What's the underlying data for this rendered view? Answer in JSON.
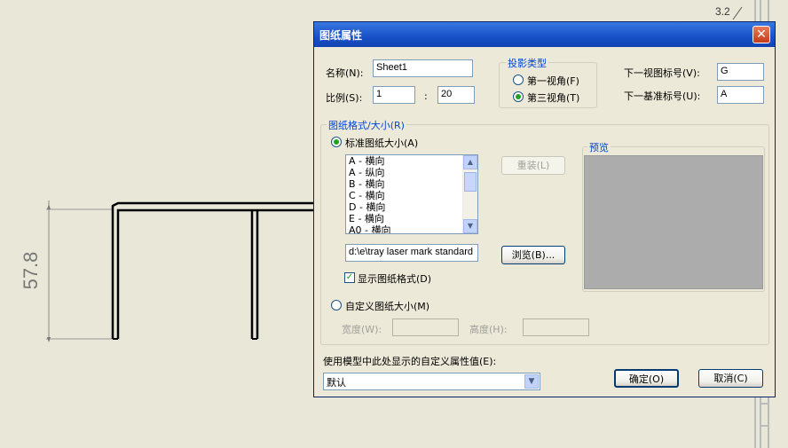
{
  "background": {
    "corner_label": "3.2",
    "dimension_label": "57.8"
  },
  "dialog": {
    "title": "图纸属性",
    "close_symbol": "✕",
    "name_label": "名称(N):",
    "name_value": "Sheet1",
    "scale_label": "比例(S):",
    "scale_left": "1",
    "scale_sep": ":",
    "scale_right": "20",
    "projection_group": "投影类型",
    "first_angle": "第一视角(F)",
    "third_angle": "第三视角(T)",
    "next_view_label": "下一视图标号(V):",
    "next_view_value": "G",
    "next_datum_label": "下一基准标号(U):",
    "next_datum_value": "A",
    "format_group": "图纸格式/大小(R)",
    "standard_size": "标准图纸大小(A)",
    "sizes": [
      "A - 横向",
      "A - 纵向",
      "B - 横向",
      "C - 横向",
      "D - 横向",
      "E - 横向",
      "A0 - 横向"
    ],
    "reload_button": "重装(L)",
    "browse_button": "浏览(B)...",
    "format_path": "d:\\e\\tray laser mark standard",
    "show_format": "显示图纸格式(D)",
    "custom_size": "自定义图纸大小(M)",
    "width_label": "宽度(W):",
    "height_label": "高度(H):",
    "preview_label": "预览",
    "custom_prop_label": "使用模型中此处显示的自定义属性值(E):",
    "custom_prop_value": "默认",
    "ok_button": "确定(O)",
    "cancel_button": "取消(C)"
  },
  "colors": {
    "title_bar": "#1750c8",
    "accent_text": "#0046d5",
    "preview_fill": "#acacac",
    "drawing_bg": "#e9e8d8"
  }
}
